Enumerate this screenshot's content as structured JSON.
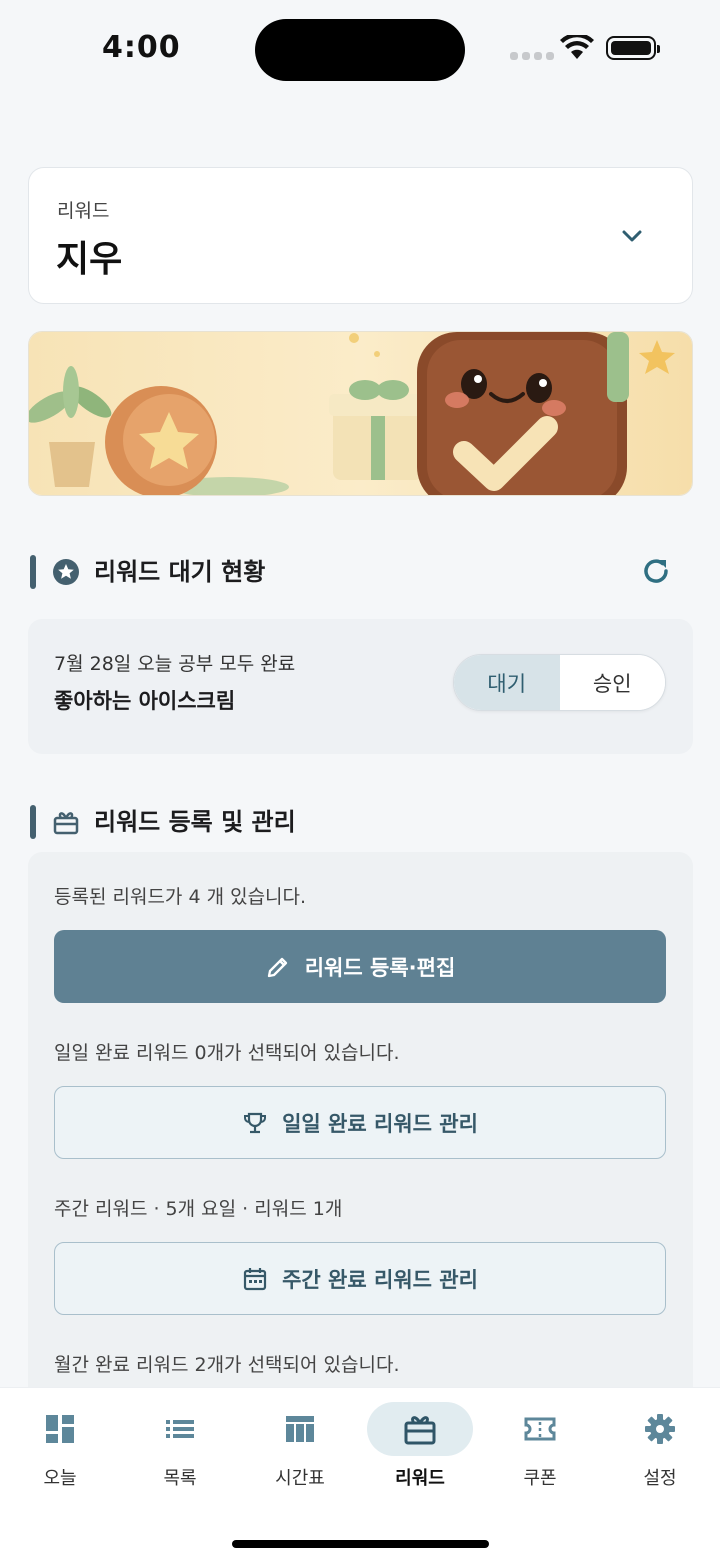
{
  "status_bar": {
    "time": "4:00"
  },
  "selector": {
    "label": "리워드",
    "value": "지우"
  },
  "sections": {
    "pending": {
      "title": "리워드 대기 현황"
    },
    "manage": {
      "title": "리워드 등록 및 관리"
    }
  },
  "pending_item": {
    "subtitle": "7월 28일 오늘 공부 모두 완료",
    "title": "좋아하는 아이스크림",
    "toggle": {
      "options": [
        "대기",
        "승인"
      ],
      "selected": "대기"
    }
  },
  "manage": {
    "registered_text": "등록된 리워드가 4 개 있습니다.",
    "edit_button": "리워드 등록·편집",
    "daily_text": "일일 완료 리워드 0개가 선택되어 있습니다.",
    "daily_button": "일일 완료 리워드 관리",
    "weekly_text": "주간 리워드 · 5개 요일 · 리워드 1개",
    "weekly_button": "주간 완료 리워드 관리",
    "monthly_text": "월간 완료 리워드 2개가 선택되어 있습니다."
  },
  "tabs": [
    {
      "label": "오늘",
      "icon": "dashboard-icon"
    },
    {
      "label": "목록",
      "icon": "list-icon"
    },
    {
      "label": "시간표",
      "icon": "table-icon"
    },
    {
      "label": "리워드",
      "icon": "gift-icon",
      "active": true
    },
    {
      "label": "쿠폰",
      "icon": "coupon-icon"
    },
    {
      "label": "설정",
      "icon": "gear-icon"
    }
  ],
  "colors": {
    "accent": "#5f8193",
    "section_bar": "#44606f",
    "active_toggle": "#d7e3e8",
    "banner_bg": "#f8e6bd"
  }
}
